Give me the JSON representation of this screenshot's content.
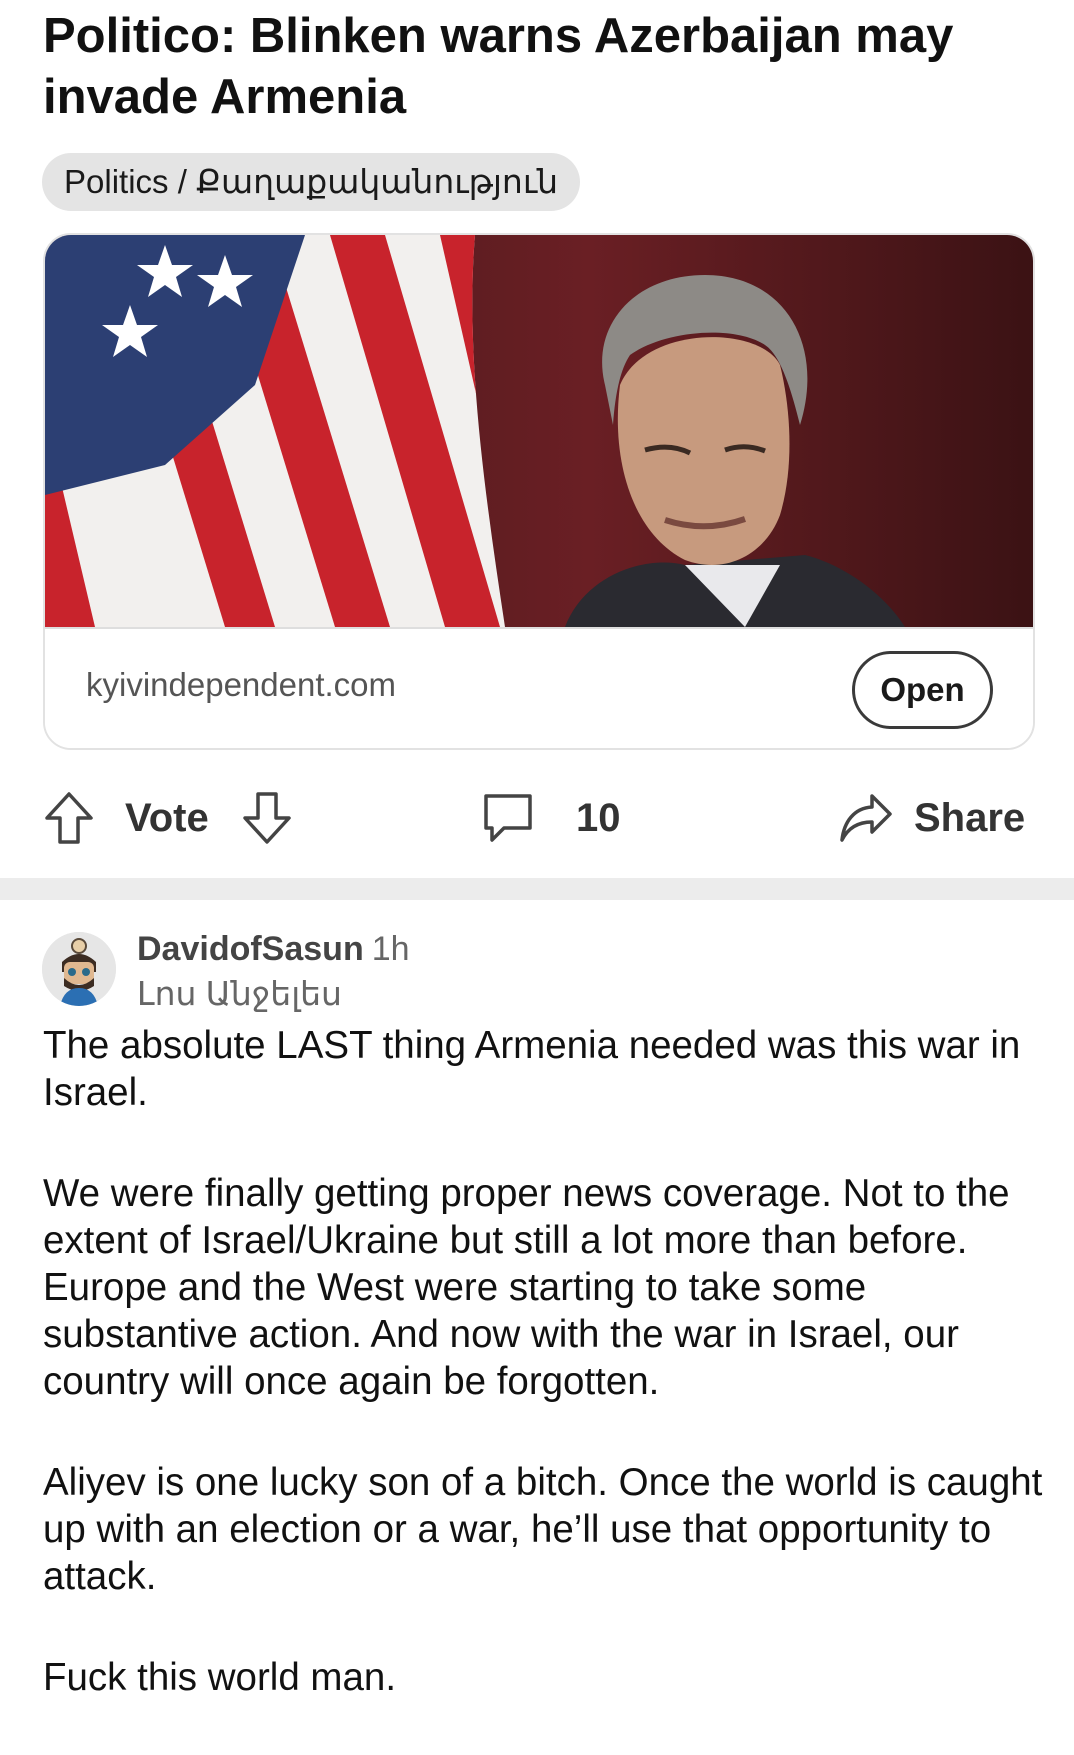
{
  "post": {
    "title": "Politico: Blinken warns Azerbaijan may invade Armenia",
    "flair": "Politics / Քաղաքականություն",
    "link": {
      "image_alt": "Photo of Antony Blinken in front of a U.S. flag",
      "domain": "kyivindependent.com",
      "open_label": "Open"
    },
    "actions": {
      "upvote_icon": "arrow-up-icon",
      "vote_label": "Vote",
      "downvote_icon": "arrow-down-icon",
      "comment_icon": "comment-bubble-icon",
      "comment_count": "10",
      "share_icon": "share-arrow-icon",
      "share_label": "Share"
    }
  },
  "comment": {
    "author": "DavidofSasun",
    "time": "1h",
    "author_flair": "Լոս Անջելես",
    "paragraphs": [
      "The absolute LAST thing Armenia needed was this war in Israel.",
      "We were finally getting proper news coverage. Not to the extent of Israel/Ukraine but still a lot more than before. Europe and the West were starting to take some substantive action. And now with the war in Israel, our country will once again be forgotten.",
      "Aliyev is one lucky son of a bitch. Once the world is caught up with an election or a war, he’ll use that opportunity to attack.",
      "Fuck this world man."
    ]
  },
  "colors": {
    "flair_bg": "#e4e4e4",
    "divider": "#ececec",
    "text": "#111111"
  }
}
